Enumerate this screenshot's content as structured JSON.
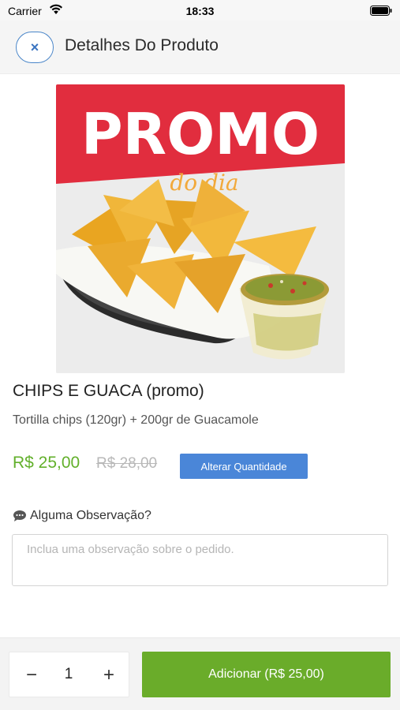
{
  "status_bar": {
    "carrier": "Carrier",
    "time": "18:33",
    "wifi_icon": "wifi-icon",
    "battery_icon": "battery-icon"
  },
  "header": {
    "close_icon": "close-icon",
    "title": "Detalhes Do Produto"
  },
  "product": {
    "image": {
      "headline": "PROMO",
      "subline": "do dia",
      "headline_color": "#e12d3e",
      "subline_color": "#f2a93b"
    },
    "name": "CHIPS E GUACA (promo)",
    "description": "Tortilla chips (120gr) + 200gr de Guacamole",
    "price": "R$ 25,00",
    "old_price": "R$ 28,00",
    "change_quantity_label": "Alterar Quantidade"
  },
  "observation": {
    "icon": "comment-icon",
    "label": "Alguma Observação?",
    "placeholder": "Inclua uma observação sobre o pedido.",
    "value": ""
  },
  "cart": {
    "minus_label": "−",
    "quantity": "1",
    "plus_label": "+",
    "add_label": "Adicionar (R$ 25,00)"
  },
  "colors": {
    "accent_blue": "#4a86d8",
    "price_green": "#62b02b",
    "add_button_green": "#6aac2a"
  }
}
